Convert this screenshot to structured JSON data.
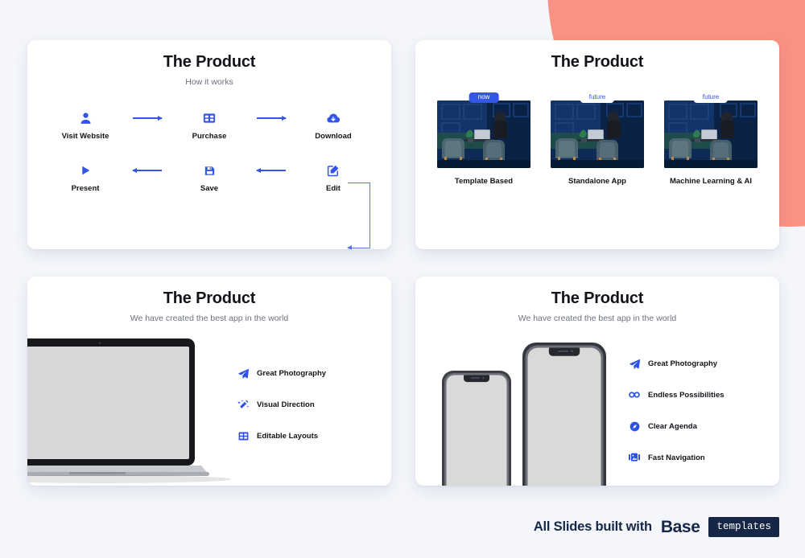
{
  "theme": {
    "page_background": "#f4f6fb",
    "accent_blue": "#3355e8",
    "coral": "#fa9283",
    "navy": "#152647",
    "title_color": "#13141a",
    "subtitle_color": "#6d7180"
  },
  "slides": [
    {
      "title": "The Product",
      "subtitle": "How it works",
      "layout": "process-flow",
      "steps_row_1": [
        {
          "label": "Visit Website",
          "icon": "user-icon"
        },
        {
          "label": "Purchase",
          "icon": "grid-cart-icon"
        },
        {
          "label": "Download",
          "icon": "cloud-download-icon"
        }
      ],
      "steps_row_2": [
        {
          "label": "Present",
          "icon": "play-icon"
        },
        {
          "label": "Save",
          "icon": "floppy-save-icon"
        },
        {
          "label": "Edit",
          "icon": "edit-pencil-icon"
        }
      ],
      "arrows_row_1": [
        "arrow-right-icon",
        "arrow-right-icon"
      ],
      "arrows_row_2": [
        "arrow-left-icon",
        "arrow-left-icon"
      ],
      "loop_connector": "loop-arrow-connector"
    },
    {
      "title": "The Product",
      "subtitle": "",
      "layout": "roadmap-thumbnails",
      "thumbnails": [
        {
          "badge": "now",
          "badge_style": "filled",
          "label": "Template Based"
        },
        {
          "badge": "future",
          "badge_style": "outline",
          "label": "Standalone App"
        },
        {
          "badge": "future",
          "badge_style": "outline",
          "label": "Machine Learning & AI"
        }
      ]
    },
    {
      "title": "The Product",
      "subtitle": "We have created the best app in the world",
      "layout": "laptop-mockup",
      "device": "macbook-mockup",
      "features": [
        {
          "label": "Great Photography",
          "icon": "paper-plane-icon"
        },
        {
          "label": "Visual Direction",
          "icon": "magic-wand-icon"
        },
        {
          "label": "Editable Layouts",
          "icon": "layout-grid-icon"
        }
      ]
    },
    {
      "title": "The Product",
      "subtitle": "We have created the best app in the world",
      "layout": "phone-mockup",
      "device": "iphone-pair-mockup",
      "features": [
        {
          "label": "Great Photography",
          "icon": "paper-plane-icon"
        },
        {
          "label": "Endless Possibilities",
          "icon": "infinity-icon"
        },
        {
          "label": "Clear Agenda",
          "icon": "compass-icon"
        },
        {
          "label": "Fast Navigation",
          "icon": "image-slider-icon"
        }
      ]
    }
  ],
  "footer": {
    "lead_text": "All Slides built with",
    "brand_word": "Base",
    "brand_chip": "templates"
  }
}
